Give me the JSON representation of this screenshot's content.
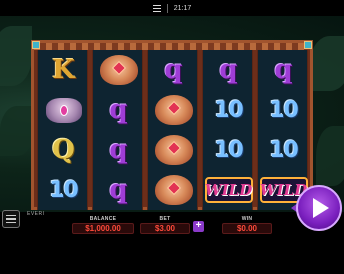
{
  "status_bar": {
    "time": "21:17"
  },
  "reels": [
    [
      {
        "type": "letter",
        "text": "K",
        "cls": "sym-k"
      },
      {
        "type": "elephant",
        "text": ""
      },
      {
        "type": "letter",
        "text": "Q",
        "cls": "sym-qa"
      },
      {
        "type": "letter",
        "text": "10",
        "cls": "sym-10"
      }
    ],
    [
      {
        "type": "lion",
        "text": ""
      },
      {
        "type": "letter",
        "text": "q",
        "cls": "sym-q"
      },
      {
        "type": "letter",
        "text": "q",
        "cls": "sym-q"
      },
      {
        "type": "letter",
        "text": "q",
        "cls": "sym-q"
      }
    ],
    [
      {
        "type": "letter",
        "text": "q",
        "cls": "sym-q"
      },
      {
        "type": "lion",
        "text": ""
      },
      {
        "type": "lion",
        "text": ""
      },
      {
        "type": "lion",
        "text": ""
      }
    ],
    [
      {
        "type": "letter",
        "text": "q",
        "cls": "sym-q"
      },
      {
        "type": "letter",
        "text": "10",
        "cls": "sym-10"
      },
      {
        "type": "letter",
        "text": "10",
        "cls": "sym-10"
      },
      {
        "type": "wild",
        "text": "WILD"
      }
    ],
    [
      {
        "type": "letter",
        "text": "q",
        "cls": "sym-q"
      },
      {
        "type": "letter",
        "text": "10",
        "cls": "sym-10"
      },
      {
        "type": "letter",
        "text": "10",
        "cls": "sym-10"
      },
      {
        "type": "wild",
        "text": "WILD"
      }
    ]
  ],
  "branding": {
    "logo": "EVERI"
  },
  "meters": {
    "balance": {
      "label": "BALANCE",
      "value": "$1,000.00"
    },
    "bet": {
      "label": "BET",
      "value": "$3.00"
    },
    "win": {
      "label": "WIN",
      "value": "$0.00"
    }
  },
  "controls": {
    "bet_increase": "+"
  },
  "colors": {
    "accent": "#8a3ac9",
    "meter_text": "#ff4a3a",
    "frame": "#a1542e"
  }
}
